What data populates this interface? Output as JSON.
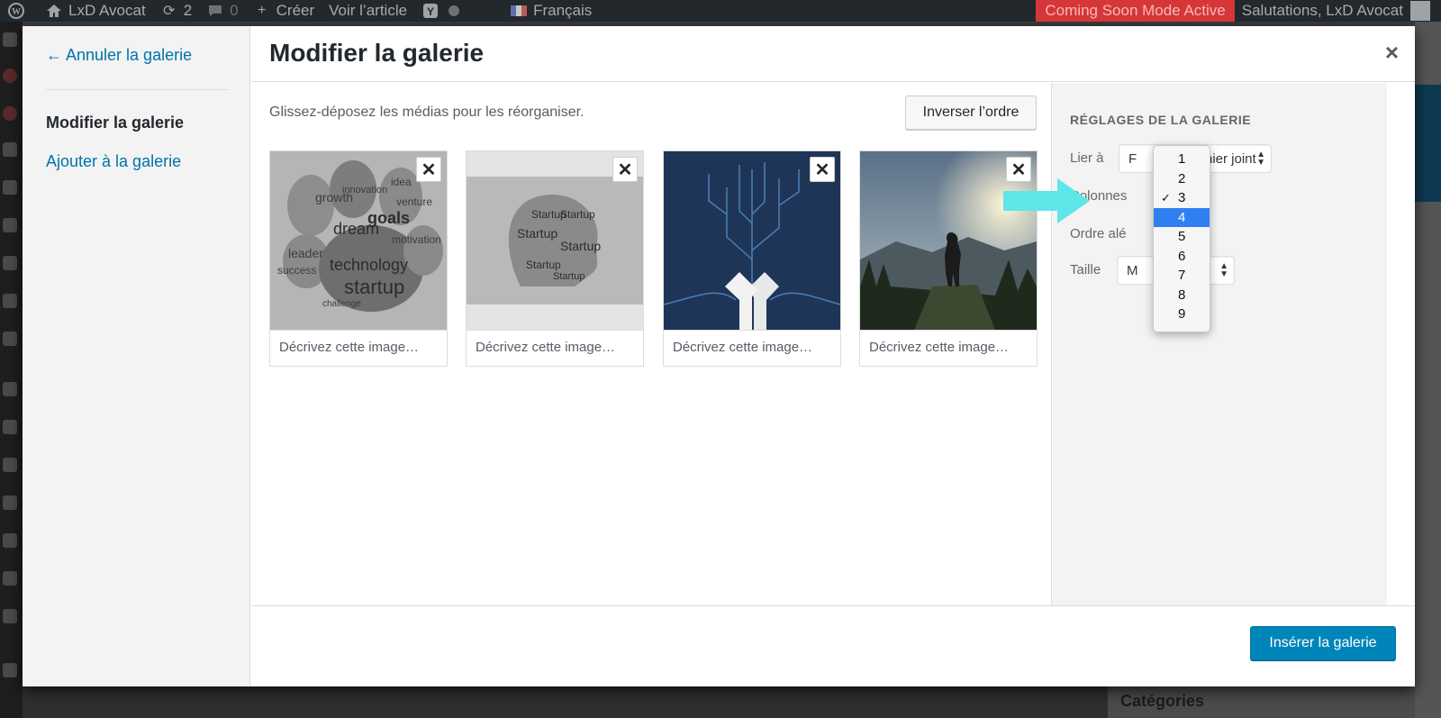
{
  "adminbar": {
    "site_name": "LxD Avocat",
    "updates_count": "2",
    "comments_count": "0",
    "new_label": "Créer",
    "view_label": "Voir l’article",
    "language": "Français",
    "coming_soon": "Coming Soon Mode Active",
    "greeting": "Salutations, LxD Avocat"
  },
  "modal": {
    "back_link": "← Annuler la galerie",
    "menu": {
      "active": "Modifier la galerie",
      "add": "Ajouter à la galerie"
    },
    "title": "Modifier la galerie",
    "close_glyph": "×",
    "hint": "Glissez-déposez les médias pour les réorganiser.",
    "reverse_button": "Inverser l’ordre",
    "remove_glyph": "✕",
    "attachments": [
      {
        "caption_placeholder": "Décrivez cette image…",
        "image": "word-cloud-paw"
      },
      {
        "caption_placeholder": "Décrivez cette image…",
        "image": "word-cloud-head"
      },
      {
        "caption_placeholder": "Décrivez cette image…",
        "image": "circuit-tree-hands"
      },
      {
        "caption_placeholder": "Décrivez cette image…",
        "image": "hiker-mountain-sunset"
      }
    ],
    "settings": {
      "heading": "RÉGLAGES DE LA GALERIE",
      "link_label": "Lier à",
      "link_value": "Fichier joint",
      "link_value_visible": "fichier joint",
      "link_value_prefix": "F",
      "columns_label": "Colonnes",
      "random_label": "Ordre aléatoire",
      "random_visible": "Ordre alé",
      "size_label": "Taille",
      "size_value_visible": "M"
    },
    "insert_button": "Insérer la galerie"
  },
  "columns_dropdown": {
    "options": [
      "1",
      "2",
      "3",
      "4",
      "5",
      "6",
      "7",
      "8",
      "9"
    ],
    "selected": "3",
    "highlighted": "4",
    "check_glyph": "✓"
  },
  "backdrop": {
    "categories_heading": "Catégories"
  },
  "colors": {
    "accent": "#0085ba",
    "link": "#0073aa",
    "coming_soon_bg": "#d63638",
    "annotation_arrow": "#5ee6e8",
    "dropdown_highlight": "#2f7ff0"
  }
}
